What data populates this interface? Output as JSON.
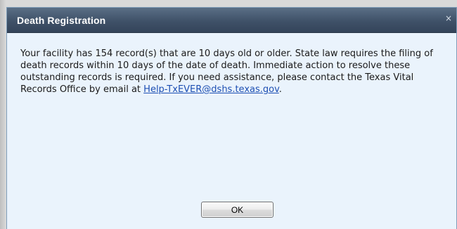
{
  "dialog": {
    "title": "Death Registration",
    "close_glyph": "×",
    "message_main": "Your facility has 154 record(s) that are 10 days old or older. State law requires the filing of death records within 10 days of the date of death. Immediate action to resolve these outstanding records is required. If you need assistance, please contact the Texas Vital Records Office by email at ",
    "email_link": "Help-TxEVER@dshs.texas.gov",
    "message_end": ".",
    "ok_label": "OK"
  },
  "icons": {
    "close": "close-icon"
  },
  "colors": {
    "titlebar": "#3f5168",
    "content_bg": "#eaf3fc",
    "link": "#1d4fb3"
  }
}
